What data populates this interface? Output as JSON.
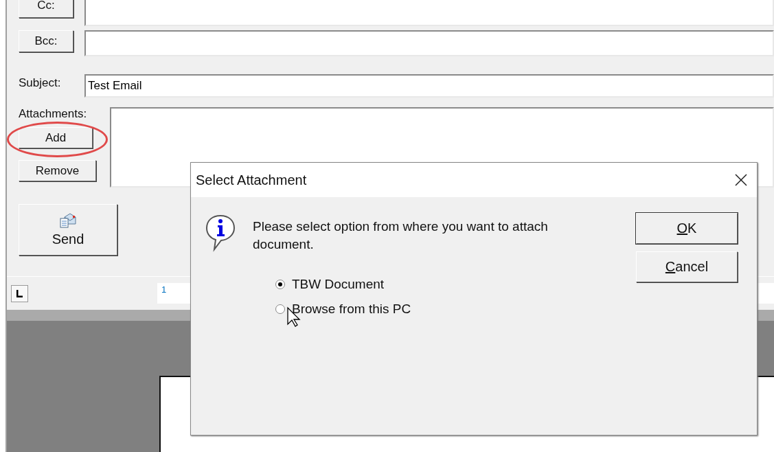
{
  "compose": {
    "cc_button": "Cc:",
    "bcc_button": "Bcc:",
    "subject_label": "Subject:",
    "subject_value": "Test Email",
    "attachments_label": "Attachments:",
    "add_button": "Add",
    "add_highlighted": true,
    "remove_button": "Remove",
    "send_button": "Send"
  },
  "ruler": {
    "mark": "1"
  },
  "dialog": {
    "title": "Select Attachment",
    "message": "Please select option from where you want to attach document.",
    "options": [
      {
        "label": "TBW Document",
        "selected": true
      },
      {
        "label": "Browse from this PC",
        "selected": false
      }
    ],
    "buttons": [
      {
        "access_key": "O",
        "label_rest": "K",
        "default": true
      },
      {
        "access_key": "C",
        "label_rest": "ancel",
        "default": false
      }
    ]
  }
}
